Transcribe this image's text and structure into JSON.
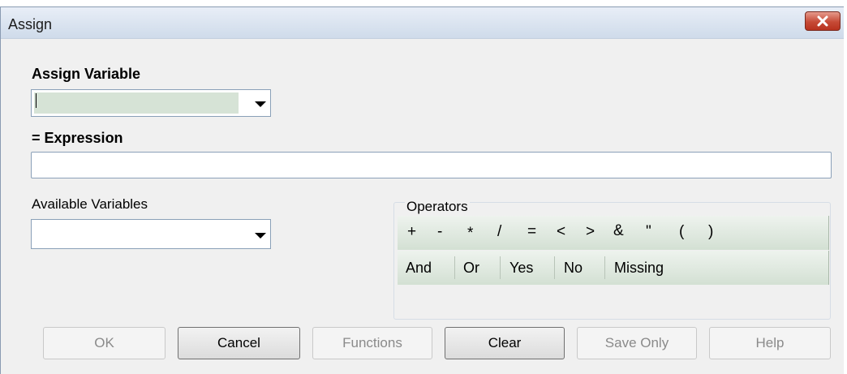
{
  "window": {
    "title": "Assign",
    "close_icon": "close-icon"
  },
  "assign_variable": {
    "label": "Assign Variable",
    "value": ""
  },
  "expression": {
    "label": "= Expression",
    "value": ""
  },
  "available_variables": {
    "label": "Available Variables",
    "value": ""
  },
  "operators": {
    "title": "Operators",
    "symbols": [
      "+",
      "-",
      "*",
      "/",
      "=",
      "<",
      ">",
      "&",
      "\"",
      "(",
      ")"
    ],
    "words": [
      "And",
      "Or",
      "Yes",
      "No",
      "Missing"
    ]
  },
  "buttons": {
    "ok": "OK",
    "cancel": "Cancel",
    "functions": "Functions",
    "clear": "Clear",
    "save_only": "Save Only",
    "help": "Help"
  },
  "colors": {
    "close_button": "#c64a36",
    "field_fill": "#d6e3d6",
    "operator_strip": "#d3e0d3"
  }
}
